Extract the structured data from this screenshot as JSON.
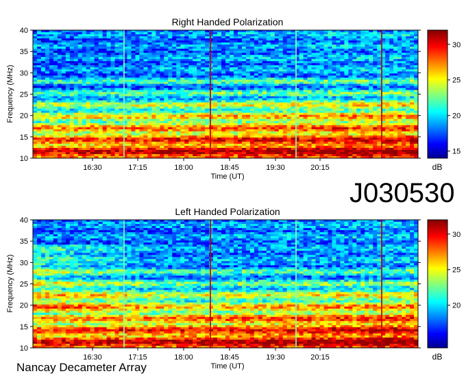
{
  "observation_id": "J030530",
  "footer": "Nancay Decameter Array",
  "chart_data": [
    {
      "type": "heatmap",
      "title": "Right Handed Polarization",
      "xlabel": "Time (UT)",
      "ylabel": "Frequency (MHz)",
      "x_ticks": [
        "16:30",
        "17:15",
        "18:00",
        "18:45",
        "19:30",
        "20:15"
      ],
      "y_ticks": [
        10,
        15,
        20,
        25,
        30,
        35,
        40
      ],
      "ylim": [
        10,
        40
      ],
      "colorbar": {
        "label": "dB",
        "ticks": [
          15,
          20,
          25,
          30
        ],
        "range": [
          14,
          32
        ]
      }
    },
    {
      "type": "heatmap",
      "title": "Left Handed Polarization",
      "xlabel": "Time (UT)",
      "ylabel": "Frequency (MHz)",
      "x_ticks": [
        "16:30",
        "17:15",
        "18:00",
        "18:45",
        "19:30",
        "20:15"
      ],
      "y_ticks": [
        10,
        15,
        20,
        25,
        30,
        35,
        40
      ],
      "ylim": [
        10,
        40
      ],
      "colorbar": {
        "label": "dB",
        "ticks": [
          20,
          25,
          30
        ],
        "range": [
          14,
          32
        ]
      }
    }
  ]
}
